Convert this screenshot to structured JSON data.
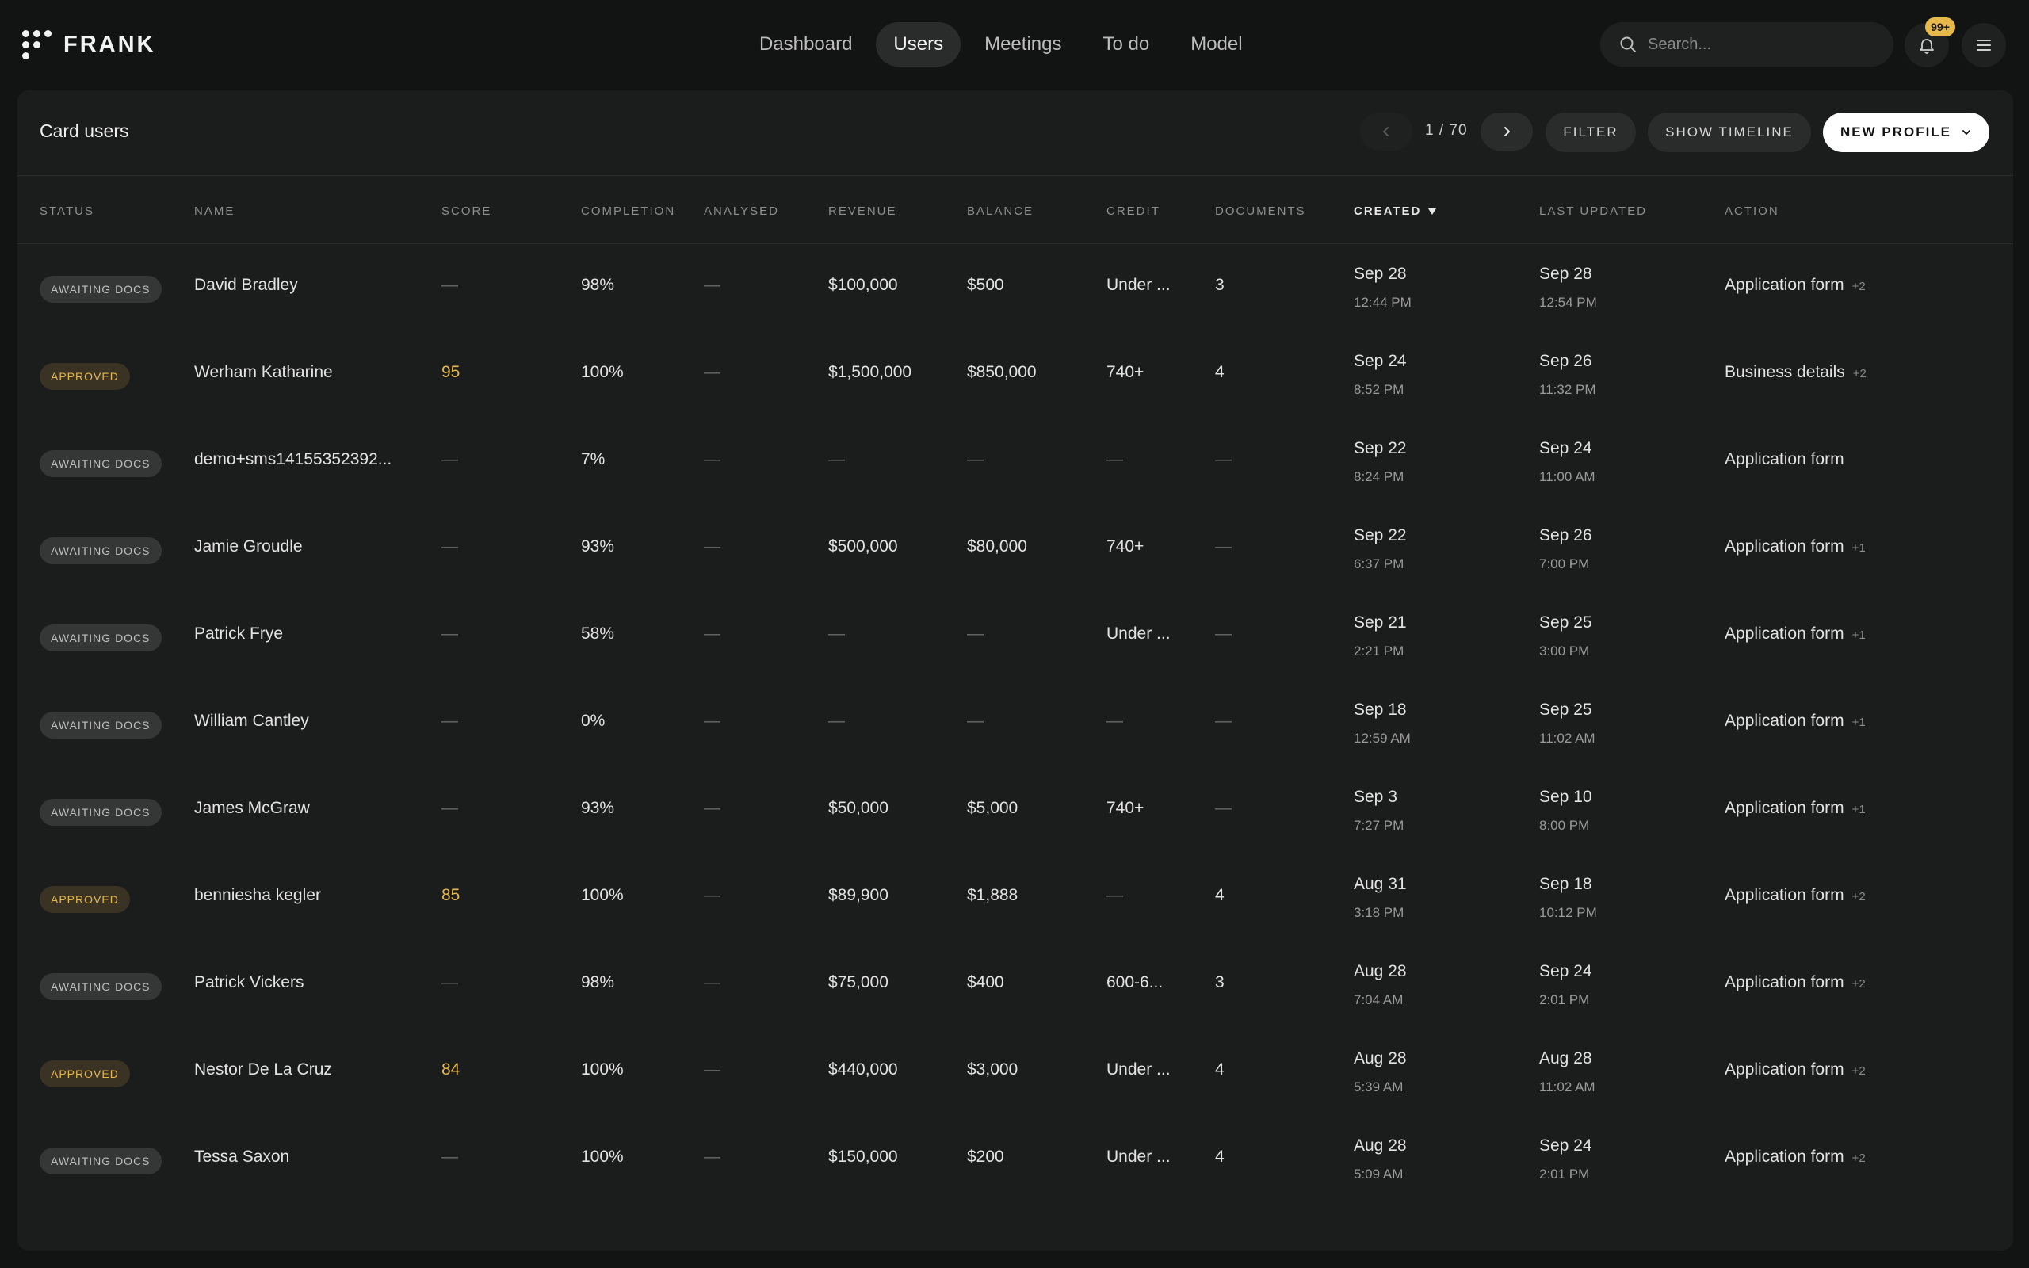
{
  "app": {
    "brand": "FRANK",
    "nav": [
      {
        "label": "Dashboard",
        "active": false
      },
      {
        "label": "Users",
        "active": true
      },
      {
        "label": "Meetings",
        "active": false
      },
      {
        "label": "To do",
        "active": false
      },
      {
        "label": "Model",
        "active": false
      }
    ],
    "search_placeholder": "Search...",
    "notification_count": "99+",
    "accent_color": "#e7b84a"
  },
  "panel": {
    "title": "Card users",
    "pagination": "1 / 70",
    "filter_label": "FILTER",
    "timeline_label": "SHOW TIMELINE",
    "new_profile_label": "NEW PROFILE"
  },
  "table": {
    "columns": {
      "status": "STATUS",
      "name": "NAME",
      "score": "SCORE",
      "completion": "COMPLETION",
      "analysed": "ANALYSED",
      "revenue": "REVENUE",
      "balance": "BALANCE",
      "credit": "CREDIT",
      "documents": "DOCUMENTS",
      "created": "CREATED",
      "last_updated": "LAST UPDATED",
      "action": "ACTION"
    },
    "sorted_column": "created",
    "rows": [
      {
        "status": "AWAITING DOCS",
        "status_type": "awaiting",
        "name": "David Bradley",
        "score": "—",
        "completion": "98%",
        "analysed": "—",
        "revenue": "$100,000",
        "balance": "$500",
        "credit": "Under ...",
        "documents": "3",
        "created_date": "Sep 28",
        "created_time": "12:44 PM",
        "updated_date": "Sep 28",
        "updated_time": "12:54 PM",
        "action": "Application form",
        "action_extra": "+2"
      },
      {
        "status": "APPROVED",
        "status_type": "approved",
        "name": "Werham Katharine",
        "score": "95",
        "completion": "100%",
        "analysed": "—",
        "revenue": "$1,500,000",
        "balance": "$850,000",
        "credit": "740+",
        "documents": "4",
        "created_date": "Sep 24",
        "created_time": "8:52 PM",
        "updated_date": "Sep 26",
        "updated_time": "11:32 PM",
        "action": "Business details",
        "action_extra": "+2"
      },
      {
        "status": "AWAITING DOCS",
        "status_type": "awaiting",
        "name": "demo+sms14155352392...",
        "score": "—",
        "completion": "7%",
        "analysed": "—",
        "revenue": "—",
        "balance": "—",
        "credit": "—",
        "documents": "—",
        "created_date": "Sep 22",
        "created_time": "8:24 PM",
        "updated_date": "Sep 24",
        "updated_time": "11:00 AM",
        "action": "Application form",
        "action_extra": ""
      },
      {
        "status": "AWAITING DOCS",
        "status_type": "awaiting",
        "name": "Jamie Groudle",
        "score": "—",
        "completion": "93%",
        "analysed": "—",
        "revenue": "$500,000",
        "balance": "$80,000",
        "credit": "740+",
        "documents": "—",
        "created_date": "Sep 22",
        "created_time": "6:37 PM",
        "updated_date": "Sep 26",
        "updated_time": "7:00 PM",
        "action": "Application form",
        "action_extra": "+1"
      },
      {
        "status": "AWAITING DOCS",
        "status_type": "awaiting",
        "name": "Patrick Frye",
        "score": "—",
        "completion": "58%",
        "analysed": "—",
        "revenue": "—",
        "balance": "—",
        "credit": "Under ...",
        "documents": "—",
        "created_date": "Sep 21",
        "created_time": "2:21 PM",
        "updated_date": "Sep 25",
        "updated_time": "3:00 PM",
        "action": "Application form",
        "action_extra": "+1"
      },
      {
        "status": "AWAITING DOCS",
        "status_type": "awaiting",
        "name": "William Cantley",
        "score": "—",
        "completion": "0%",
        "analysed": "—",
        "revenue": "—",
        "balance": "—",
        "credit": "—",
        "documents": "—",
        "created_date": "Sep 18",
        "created_time": "12:59 AM",
        "updated_date": "Sep 25",
        "updated_time": "11:02 AM",
        "action": "Application form",
        "action_extra": "+1"
      },
      {
        "status": "AWAITING DOCS",
        "status_type": "awaiting",
        "name": "James McGraw",
        "score": "—",
        "completion": "93%",
        "analysed": "—",
        "revenue": "$50,000",
        "balance": "$5,000",
        "credit": "740+",
        "documents": "—",
        "created_date": "Sep 3",
        "created_time": "7:27 PM",
        "updated_date": "Sep 10",
        "updated_time": "8:00 PM",
        "action": "Application form",
        "action_extra": "+1"
      },
      {
        "status": "APPROVED",
        "status_type": "approved",
        "name": "benniesha kegler",
        "score": "85",
        "completion": "100%",
        "analysed": "—",
        "revenue": "$89,900",
        "balance": "$1,888",
        "credit": "—",
        "documents": "4",
        "created_date": "Aug 31",
        "created_time": "3:18 PM",
        "updated_date": "Sep 18",
        "updated_time": "10:12 PM",
        "action": "Application form",
        "action_extra": "+2"
      },
      {
        "status": "AWAITING DOCS",
        "status_type": "awaiting",
        "name": "Patrick Vickers",
        "score": "—",
        "completion": "98%",
        "analysed": "—",
        "revenue": "$75,000",
        "balance": "$400",
        "credit": "600-6...",
        "documents": "3",
        "created_date": "Aug 28",
        "created_time": "7:04 AM",
        "updated_date": "Sep 24",
        "updated_time": "2:01 PM",
        "action": "Application form",
        "action_extra": "+2"
      },
      {
        "status": "APPROVED",
        "status_type": "approved",
        "name": "Nestor De La Cruz",
        "score": "84",
        "completion": "100%",
        "analysed": "—",
        "revenue": "$440,000",
        "balance": "$3,000",
        "credit": "Under ...",
        "documents": "4",
        "created_date": "Aug 28",
        "created_time": "5:39 AM",
        "updated_date": "Aug 28",
        "updated_time": "11:02 AM",
        "action": "Application form",
        "action_extra": "+2"
      },
      {
        "status": "AWAITING DOCS",
        "status_type": "awaiting",
        "name": "Tessa Saxon",
        "score": "—",
        "completion": "100%",
        "analysed": "—",
        "revenue": "$150,000",
        "balance": "$200",
        "credit": "Under ...",
        "documents": "4",
        "created_date": "Aug 28",
        "created_time": "5:09 AM",
        "updated_date": "Sep 24",
        "updated_time": "2:01 PM",
        "action": "Application form",
        "action_extra": "+2"
      }
    ]
  }
}
